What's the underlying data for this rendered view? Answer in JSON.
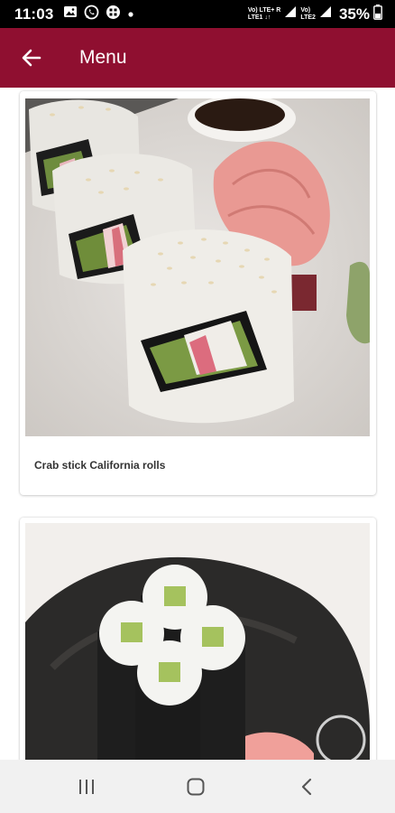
{
  "status_bar": {
    "time": "11:03",
    "network_label_1": "Vo) LTE+ R",
    "network_label_2": "LTE1 ↓↑",
    "network_label_3": "Vo)",
    "network_label_4": "LTE2",
    "battery": "35%",
    "icons": [
      "image-icon",
      "whatsapp-icon",
      "grid-app-icon",
      "dot-icon",
      "signal-icon",
      "battery-icon"
    ]
  },
  "app_bar": {
    "title": "Menu",
    "color": "#8f0f30"
  },
  "menu_items": [
    {
      "name": "Crab stick California rolls"
    },
    {
      "name": ""
    }
  ],
  "nav_bar": {
    "icons": [
      "recents-icon",
      "home-icon",
      "back-icon"
    ]
  }
}
